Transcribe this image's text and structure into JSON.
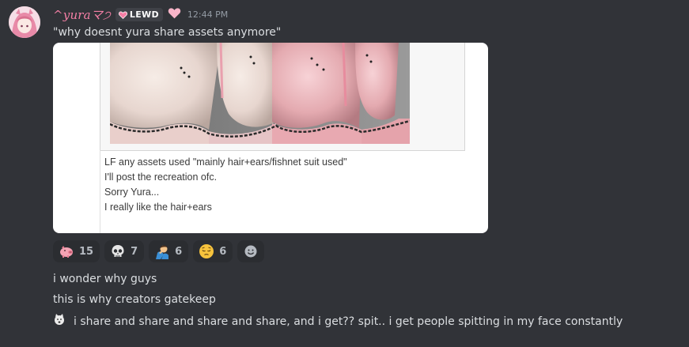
{
  "message": {
    "username": "^yuraマ੭",
    "tag_label": "LEWD",
    "timestamp": "12:44 PM",
    "first_line": "\"why doesnt yura share assets anymore\""
  },
  "embed": {
    "lines": [
      "LF any assets used \"mainly hair+ears/fishnet suit used\"",
      "I'll post the recreation ofc.",
      "Sorry Yura...",
      "I really like the hair+ears"
    ]
  },
  "reactions": [
    {
      "icon": "pig-emoji",
      "count": "15"
    },
    {
      "icon": "skull-emoji",
      "count": "7"
    },
    {
      "icon": "person-facepalm-emoji",
      "count": "6"
    },
    {
      "icon": "pensive-face-emoji",
      "count": "6"
    }
  ],
  "add_reaction_icon": "add-reaction-icon",
  "follow_up": [
    "i wonder why guys",
    "this is why creators gatekeep",
    "i share and share and share and share, and i get?? spit.. i get people spitting in my face constantly"
  ],
  "colors": {
    "background": "#313338",
    "username": "#f47fa5",
    "text": "#dbdee1",
    "timestamp": "#949ba4",
    "reaction_bg": "#2b2d31"
  }
}
